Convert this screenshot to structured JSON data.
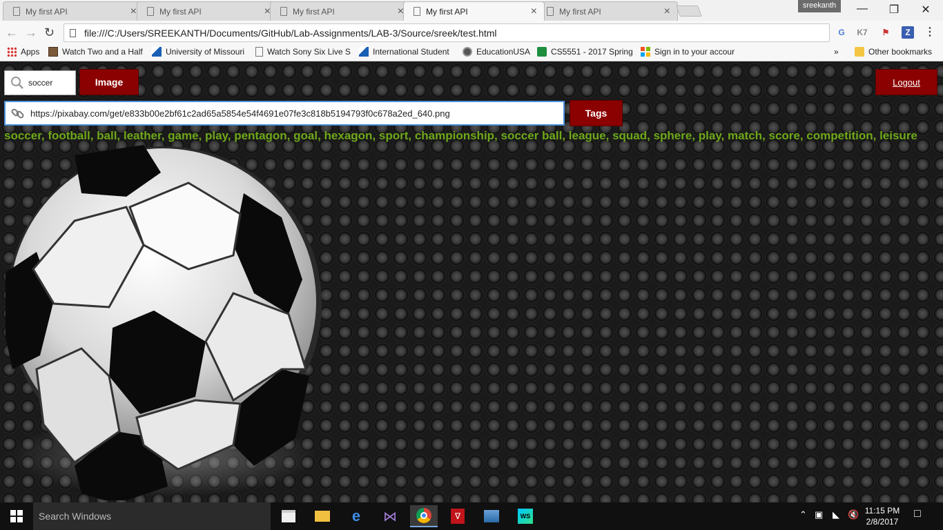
{
  "browser": {
    "tabs": [
      {
        "title": "My first API",
        "active": false
      },
      {
        "title": "My first API",
        "active": false
      },
      {
        "title": "My first API",
        "active": false
      },
      {
        "title": "My first API",
        "active": true
      },
      {
        "title": "My first API",
        "active": false
      }
    ],
    "user": "sreekanth",
    "url": "file:///C:/Users/SREEKANTH/Documents/GitHub/Lab-Assignments/LAB-3/Source/sreek/test.html",
    "bookmarks": [
      {
        "label": "Apps",
        "icon": "apps-grid-icon"
      },
      {
        "label": "Watch Two and a Half",
        "icon": "film-icon"
      },
      {
        "label": "University of Missouri",
        "icon": "flag-icon"
      },
      {
        "label": "Watch Sony Six Live St",
        "icon": "doc-icon"
      },
      {
        "label": "International Student",
        "icon": "flag-icon"
      },
      {
        "label": "EducationUSA",
        "icon": "seal-icon"
      },
      {
        "label": "CS5551 - 2017 Spring",
        "icon": "sheet-icon"
      },
      {
        "label": "Sign in to your accour",
        "icon": "microsoft-icon"
      }
    ],
    "bookmarks_overflow": "»",
    "other_bookmarks": "Other bookmarks"
  },
  "app": {
    "search_value": "soccer",
    "image_button": "Image",
    "image_url": "https://pixabay.com/get/e833b00e2bf61c2ad65a5854e54f4691e07fe3c818b5194793f0c678a2ed_640.png",
    "tags_button": "Tags",
    "tags_result": "soccer, football, ball, leather, game, play, pentagon, goal, hexagon, sport, championship, soccer ball, league, squad, sphere, play, match, score, competition, leisure",
    "logout": "Logout",
    "colors": {
      "button_red": "#8b0000",
      "tag_green": "#6fa81a"
    }
  },
  "taskbar": {
    "search_placeholder": "Search Windows",
    "time": "11:15 PM",
    "date": "2/8/2017"
  }
}
